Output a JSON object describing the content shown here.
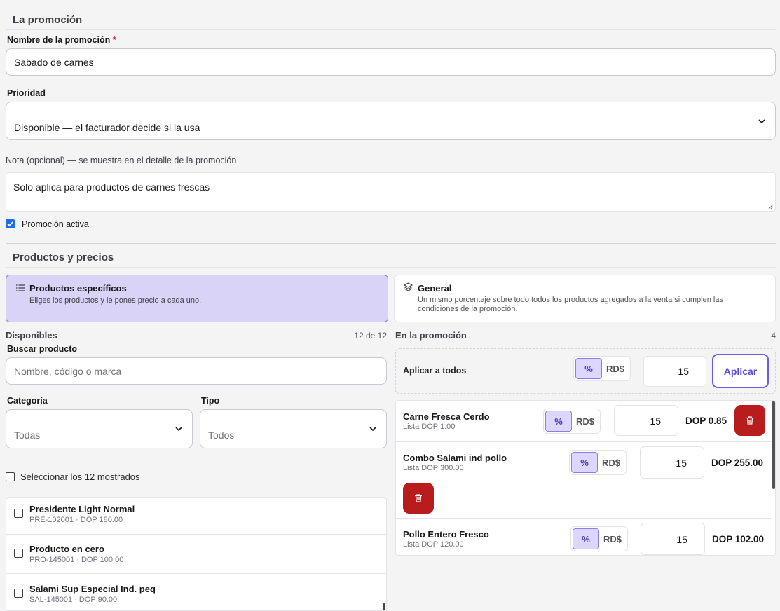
{
  "promo": {
    "title": "La promoción",
    "name_label": "Nombre de la promoción",
    "name_required_mark": "*",
    "name_value": "Sabado de carnes",
    "priority_label": "Prioridad",
    "priority_value": "Disponible — el facturador decide si la usa",
    "note_label": "Nota (opcional) — se muestra en el detalle de la promoción",
    "note_value": "Solo aplica para productos de carnes frescas",
    "active_label": "Promoción activa",
    "active_checked": true
  },
  "products": {
    "title": "Productos y precios",
    "modes": [
      {
        "title": "Productos específicos",
        "desc": "Eliges los productos y le pones precio a cada uno.",
        "selected": true,
        "icon": "list-icon"
      },
      {
        "title": "General",
        "desc": "Un mismo porcentaje sobre todo todos los productos agregados a la venta si cumplen las condiciones de la promoción.",
        "selected": false,
        "icon": "layers-icon"
      }
    ]
  },
  "available": {
    "title": "Disponibles",
    "count": "12 de 12",
    "search_label": "Buscar producto",
    "search_placeholder": "Nombre, código o marca",
    "category_label": "Categoría",
    "category_value": "Todas",
    "type_label": "Tipo",
    "type_value": "Todos",
    "select_all_label": "Seleccionar los 12 mostrados",
    "items": [
      {
        "name": "Presidente Light Normal",
        "meta": "PRE-102001 · DOP 180.00"
      },
      {
        "name": "Producto en cero",
        "meta": "PRO-145001 · DOP 100.00"
      },
      {
        "name": "Salami Sup Especial Ind. peq",
        "meta": "SAL-145001 · DOP 90.00"
      }
    ]
  },
  "in_promo": {
    "title": "En la promoción",
    "count": "4",
    "apply_all_label": "Aplicar a todos",
    "percent_label": "%",
    "currency_label": "RD$",
    "apply_all_value": "15",
    "apply_button": "Aplicar",
    "items": [
      {
        "name": "Carne Fresca Cerdo",
        "list": "Lista DOP 1.00",
        "value": "15",
        "price": "DOP 0.85"
      },
      {
        "name": "Combo Salami ind pollo",
        "list": "Lista DOP 300.00",
        "value": "15",
        "price": "DOP 255.00"
      },
      {
        "name": "Pollo Entero Fresco",
        "list": "Lista DOP 120.00",
        "value": "15",
        "price": "DOP 102.00"
      }
    ]
  },
  "colors": {
    "accent": "#6d5ae6",
    "selected_bg": "#d9d3f7",
    "danger": "#b91c1c"
  }
}
